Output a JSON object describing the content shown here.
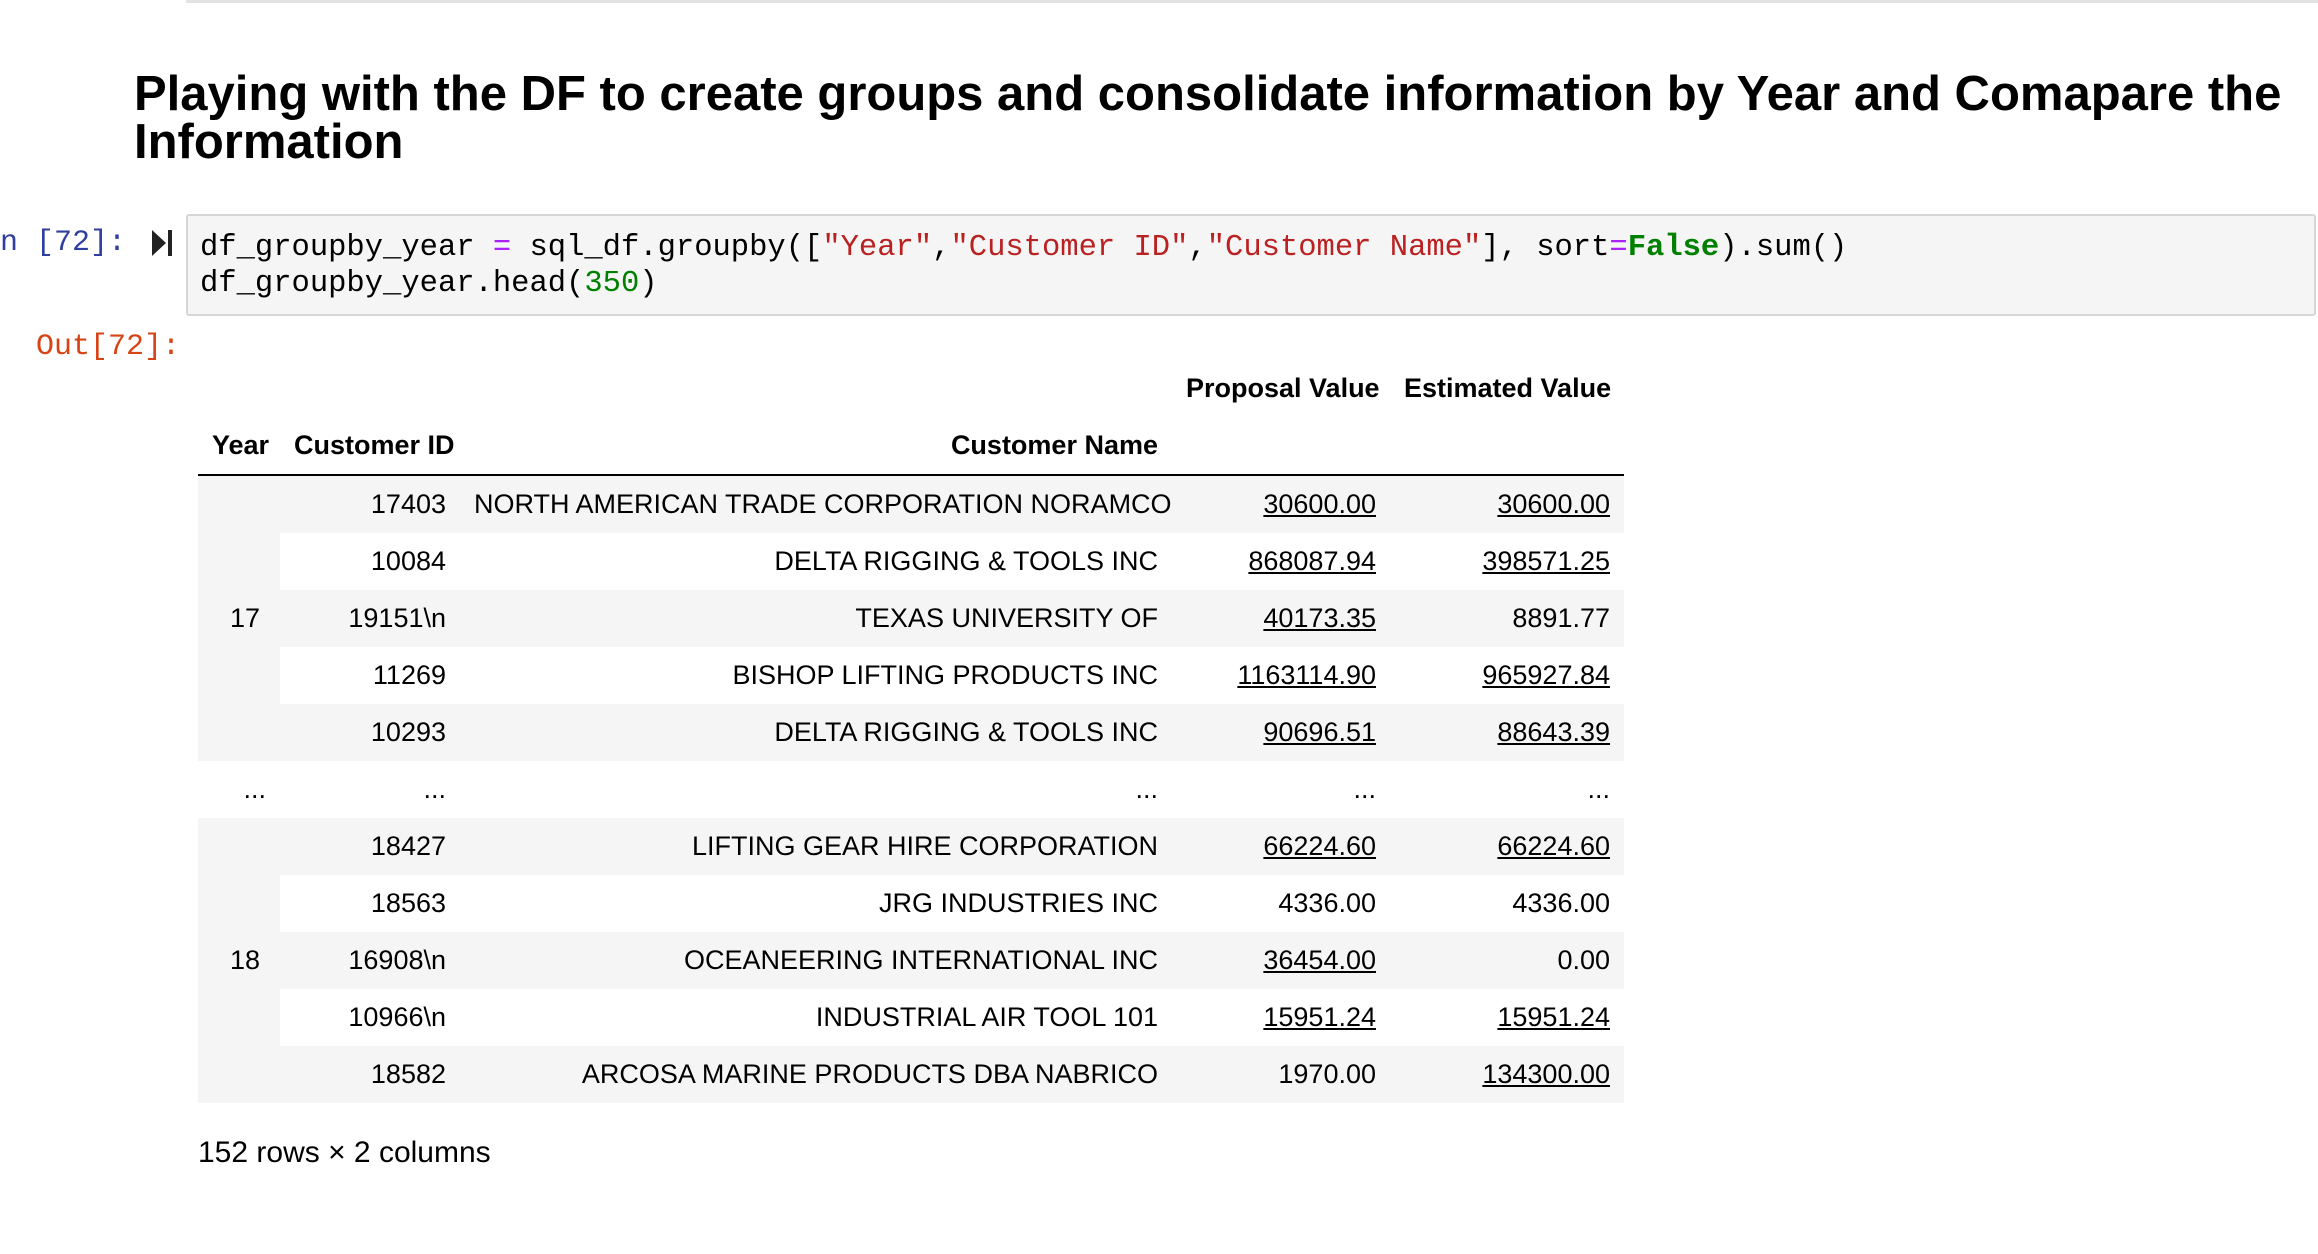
{
  "heading": "Playing with the DF to create groups and consolidate information by Year and Comapare the Information",
  "cell": {
    "in_prompt": "n [72]:",
    "out_prompt": "Out[72]:",
    "code": {
      "l1_var": "df_groupby_year ",
      "l1_eq": "=",
      "l1_call": " sql_df.groupby([",
      "l1_s1": "\"Year\"",
      "l1_c1": ",",
      "l1_s2": "\"Customer ID\"",
      "l1_c2": ",",
      "l1_s3": "\"Customer Name\"",
      "l1_tail1": "], sort",
      "l1_eq2": "=",
      "l1_kw": "False",
      "l1_tail2": ").sum()",
      "l2_head": "df_groupby_year.head(",
      "l2_num": "350",
      "l2_tail": ")"
    }
  },
  "table": {
    "value_columns": [
      "Proposal Value",
      "Estimated Value"
    ],
    "index_names": [
      "Year",
      "Customer ID",
      "Customer Name"
    ],
    "rows": [
      {
        "year": "",
        "id": "17403",
        "name": "NORTH AMERICAN TRADE CORPORATION NORAMCO",
        "proposal": "30600.00",
        "estimated": "30600.00",
        "pu": true,
        "eu": true
      },
      {
        "year": "",
        "id": "10084",
        "name": "DELTA RIGGING & TOOLS INC",
        "proposal": "868087.94",
        "estimated": "398571.25",
        "pu": true,
        "eu": true
      },
      {
        "year": "17",
        "id": "19151\\n",
        "name": "TEXAS UNIVERSITY OF",
        "proposal": "40173.35",
        "estimated": "8891.77",
        "pu": true,
        "eu": false
      },
      {
        "year": "",
        "id": "11269",
        "name": "BISHOP LIFTING PRODUCTS INC",
        "proposal": "1163114.90",
        "estimated": "965927.84",
        "pu": true,
        "eu": true
      },
      {
        "year": "",
        "id": "10293",
        "name": "DELTA RIGGING & TOOLS INC",
        "proposal": "90696.51",
        "estimated": "88643.39",
        "pu": true,
        "eu": true
      },
      {
        "year": "...",
        "id": "...",
        "name": "...",
        "proposal": "...",
        "estimated": "...",
        "pu": false,
        "eu": false
      },
      {
        "year": "",
        "id": "18427",
        "name": "LIFTING GEAR HIRE CORPORATION",
        "proposal": "66224.60",
        "estimated": "66224.60",
        "pu": true,
        "eu": true
      },
      {
        "year": "",
        "id": "18563",
        "name": "JRG INDUSTRIES INC",
        "proposal": "4336.00",
        "estimated": "4336.00",
        "pu": false,
        "eu": false
      },
      {
        "year": "18",
        "id": "16908\\n",
        "name": "OCEANEERING INTERNATIONAL INC",
        "proposal": "36454.00",
        "estimated": "0.00",
        "pu": true,
        "eu": false
      },
      {
        "year": "",
        "id": "10966\\n",
        "name": "INDUSTRIAL AIR TOOL 101",
        "proposal": "15951.24",
        "estimated": "15951.24",
        "pu": true,
        "eu": true
      },
      {
        "year": "",
        "id": "18582",
        "name": "ARCOSA MARINE PRODUCTS DBA NABRICO",
        "proposal": "1970.00",
        "estimated": "134300.00",
        "pu": false,
        "eu": true
      }
    ],
    "shape": "152 rows × 2 columns"
  },
  "icons": {
    "run": "run-cell-icon"
  }
}
